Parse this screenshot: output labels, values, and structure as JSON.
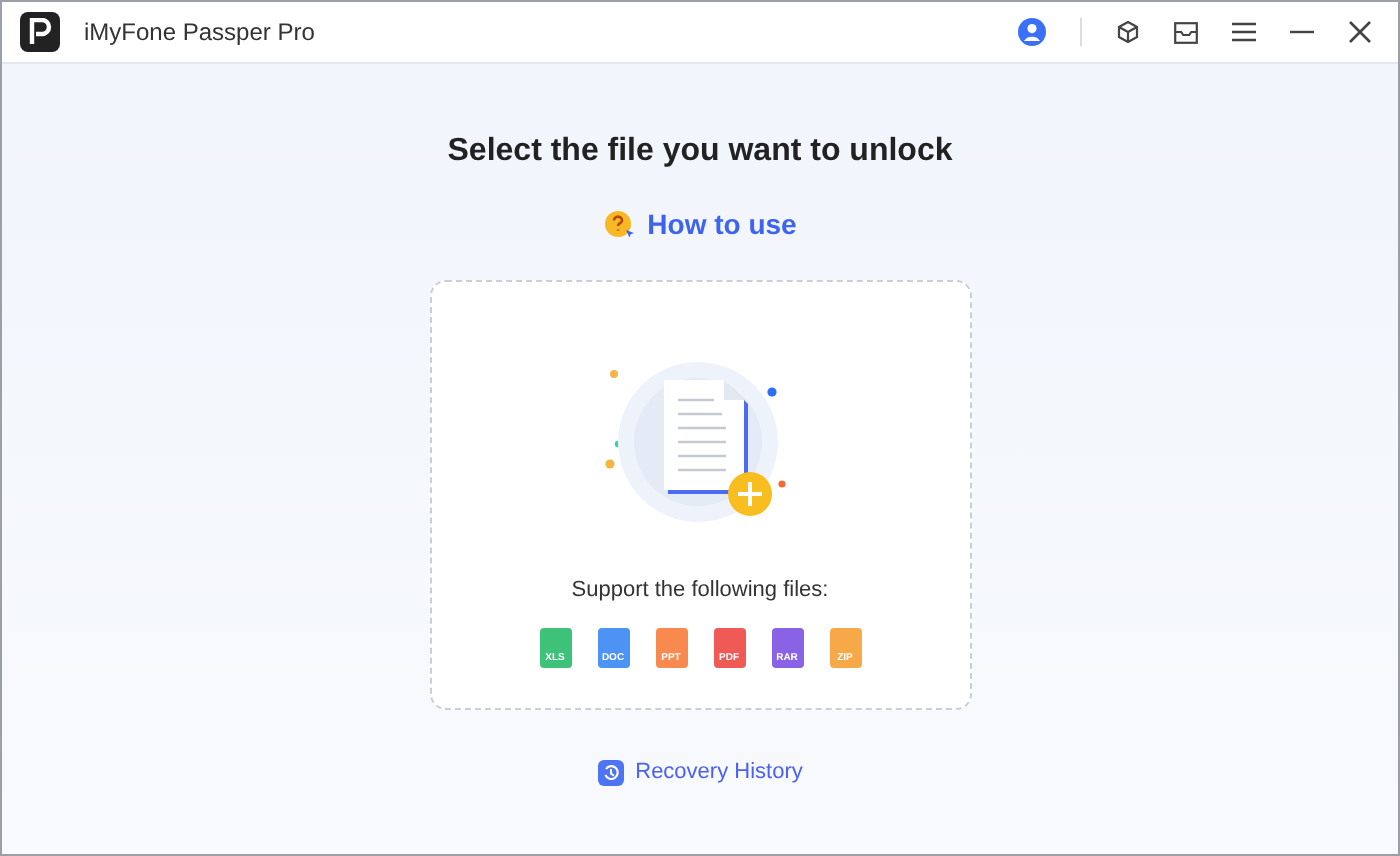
{
  "window": {
    "title": "iMyFone Passper Pro"
  },
  "heading": "Select the file you want to unlock",
  "how_to_use": "How to use",
  "drop_area": {
    "support_label": "Support the following files:",
    "file_types": [
      {
        "label": "XLS",
        "color": "#3ec27a"
      },
      {
        "label": "DOC",
        "color": "#4c93f5"
      },
      {
        "label": "PPT",
        "color": "#f98a4f"
      },
      {
        "label": "PDF",
        "color": "#ef5a57"
      },
      {
        "label": "RAR",
        "color": "#8a62e6"
      },
      {
        "label": "ZIP",
        "color": "#f7a94a"
      }
    ]
  },
  "recovery_history": "Recovery History"
}
